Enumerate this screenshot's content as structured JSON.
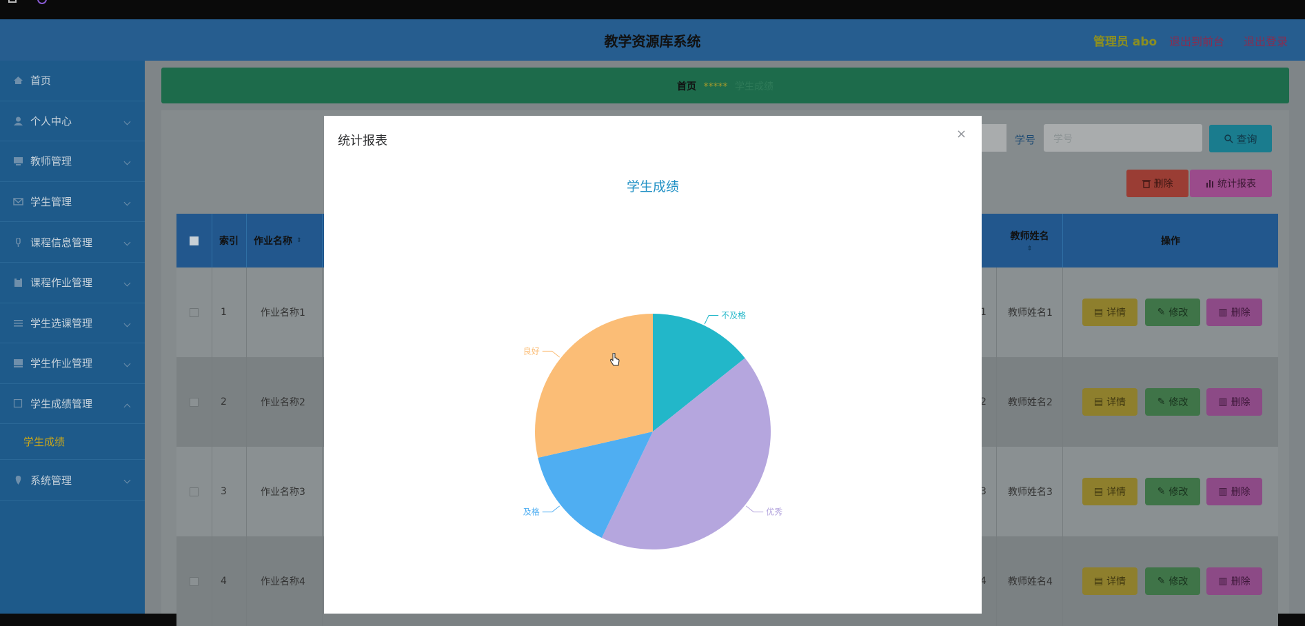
{
  "app": {
    "title": "教学资源库系统",
    "admin_label": "管理员 abo",
    "back_link": "退出到前台",
    "logout_link": "退出登录"
  },
  "sidebar": {
    "items": [
      {
        "label": "首页",
        "icon": "home-icon"
      },
      {
        "label": "个人中心",
        "icon": "user-icon"
      },
      {
        "label": "教师管理",
        "icon": "monitor-icon"
      },
      {
        "label": "学生管理",
        "icon": "mail-icon"
      },
      {
        "label": "课程信息管理",
        "icon": "mic-icon"
      },
      {
        "label": "课程作业管理",
        "icon": "clipboard-icon"
      },
      {
        "label": "学生选课管理",
        "icon": "list-icon"
      },
      {
        "label": "学生作业管理",
        "icon": "book-icon"
      },
      {
        "label": "学生成绩管理",
        "icon": "square-icon"
      },
      {
        "label": "系统管理",
        "icon": "pin-icon"
      }
    ],
    "active_sub": "学生成绩"
  },
  "breadcrumb": {
    "home": "首页",
    "separator": "*****",
    "current": "学生成绩"
  },
  "search": {
    "label": "学号",
    "placeholder": "学号",
    "query_button": "查询"
  },
  "toolbar": {
    "delete_button": "删除",
    "stats_button": "统计报表"
  },
  "table": {
    "headers": {
      "index": "索引",
      "name": "作业名称",
      "teacher": "教师姓名",
      "ops": "操作"
    },
    "rows": [
      {
        "index": "1",
        "name": "作业名称1",
        "id_tail": "1",
        "teacher": "教师姓名1"
      },
      {
        "index": "2",
        "name": "作业名称2",
        "id_tail": "2",
        "teacher": "教师姓名2"
      },
      {
        "index": "3",
        "name": "作业名称3",
        "id_tail": "3",
        "teacher": "教师姓名3"
      },
      {
        "index": "4",
        "name": "作业名称4",
        "id_tail": "4",
        "teacher": "教师姓名4"
      }
    ],
    "actions": {
      "detail": "详情",
      "edit": "修改",
      "delete": "删除"
    }
  },
  "modal": {
    "title": "统计报表",
    "close": "×"
  },
  "chart_data": {
    "type": "pie",
    "title": "学生成绩",
    "slices": [
      {
        "label": "不及格",
        "value": 1,
        "color": "#22b7c9"
      },
      {
        "label": "优秀",
        "value": 3,
        "color": "#b5a6de"
      },
      {
        "label": "及格",
        "value": 1,
        "color": "#4faef2"
      },
      {
        "label": "良好",
        "value": 2,
        "color": "#fbbd76"
      }
    ]
  },
  "colors": {
    "header": "#265d8f",
    "sidebar": "#1e5a8a",
    "accent": "#1e8fc4"
  }
}
